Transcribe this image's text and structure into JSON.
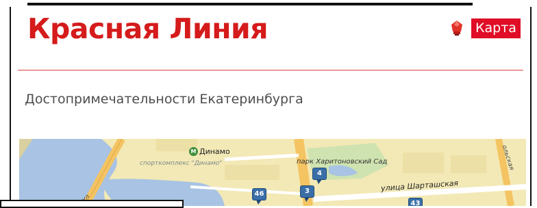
{
  "header": {
    "site_title": "Красная Линия",
    "map_link_label": "Карта"
  },
  "content": {
    "subtitle": "Достопримечательности Екатеринбурга"
  },
  "map": {
    "labels": {
      "metro": "Динамо",
      "metro_symbol": "М",
      "sport": "спорткомплекс \"Динамо\"",
      "park": "парк Харитоновский Сад",
      "street_shartashskaya": "улица Шарташская",
      "street_partial_left": "ул",
      "street_partial_right": "ольская"
    },
    "markers": [
      "46",
      "3",
      "4",
      "43"
    ]
  },
  "colors": {
    "brand_red": "#d51b1b",
    "link_bg": "#e00d26",
    "marker_blue": "#3a6fa8"
  },
  "icons": {
    "map_link": "red-lantern-icon"
  }
}
